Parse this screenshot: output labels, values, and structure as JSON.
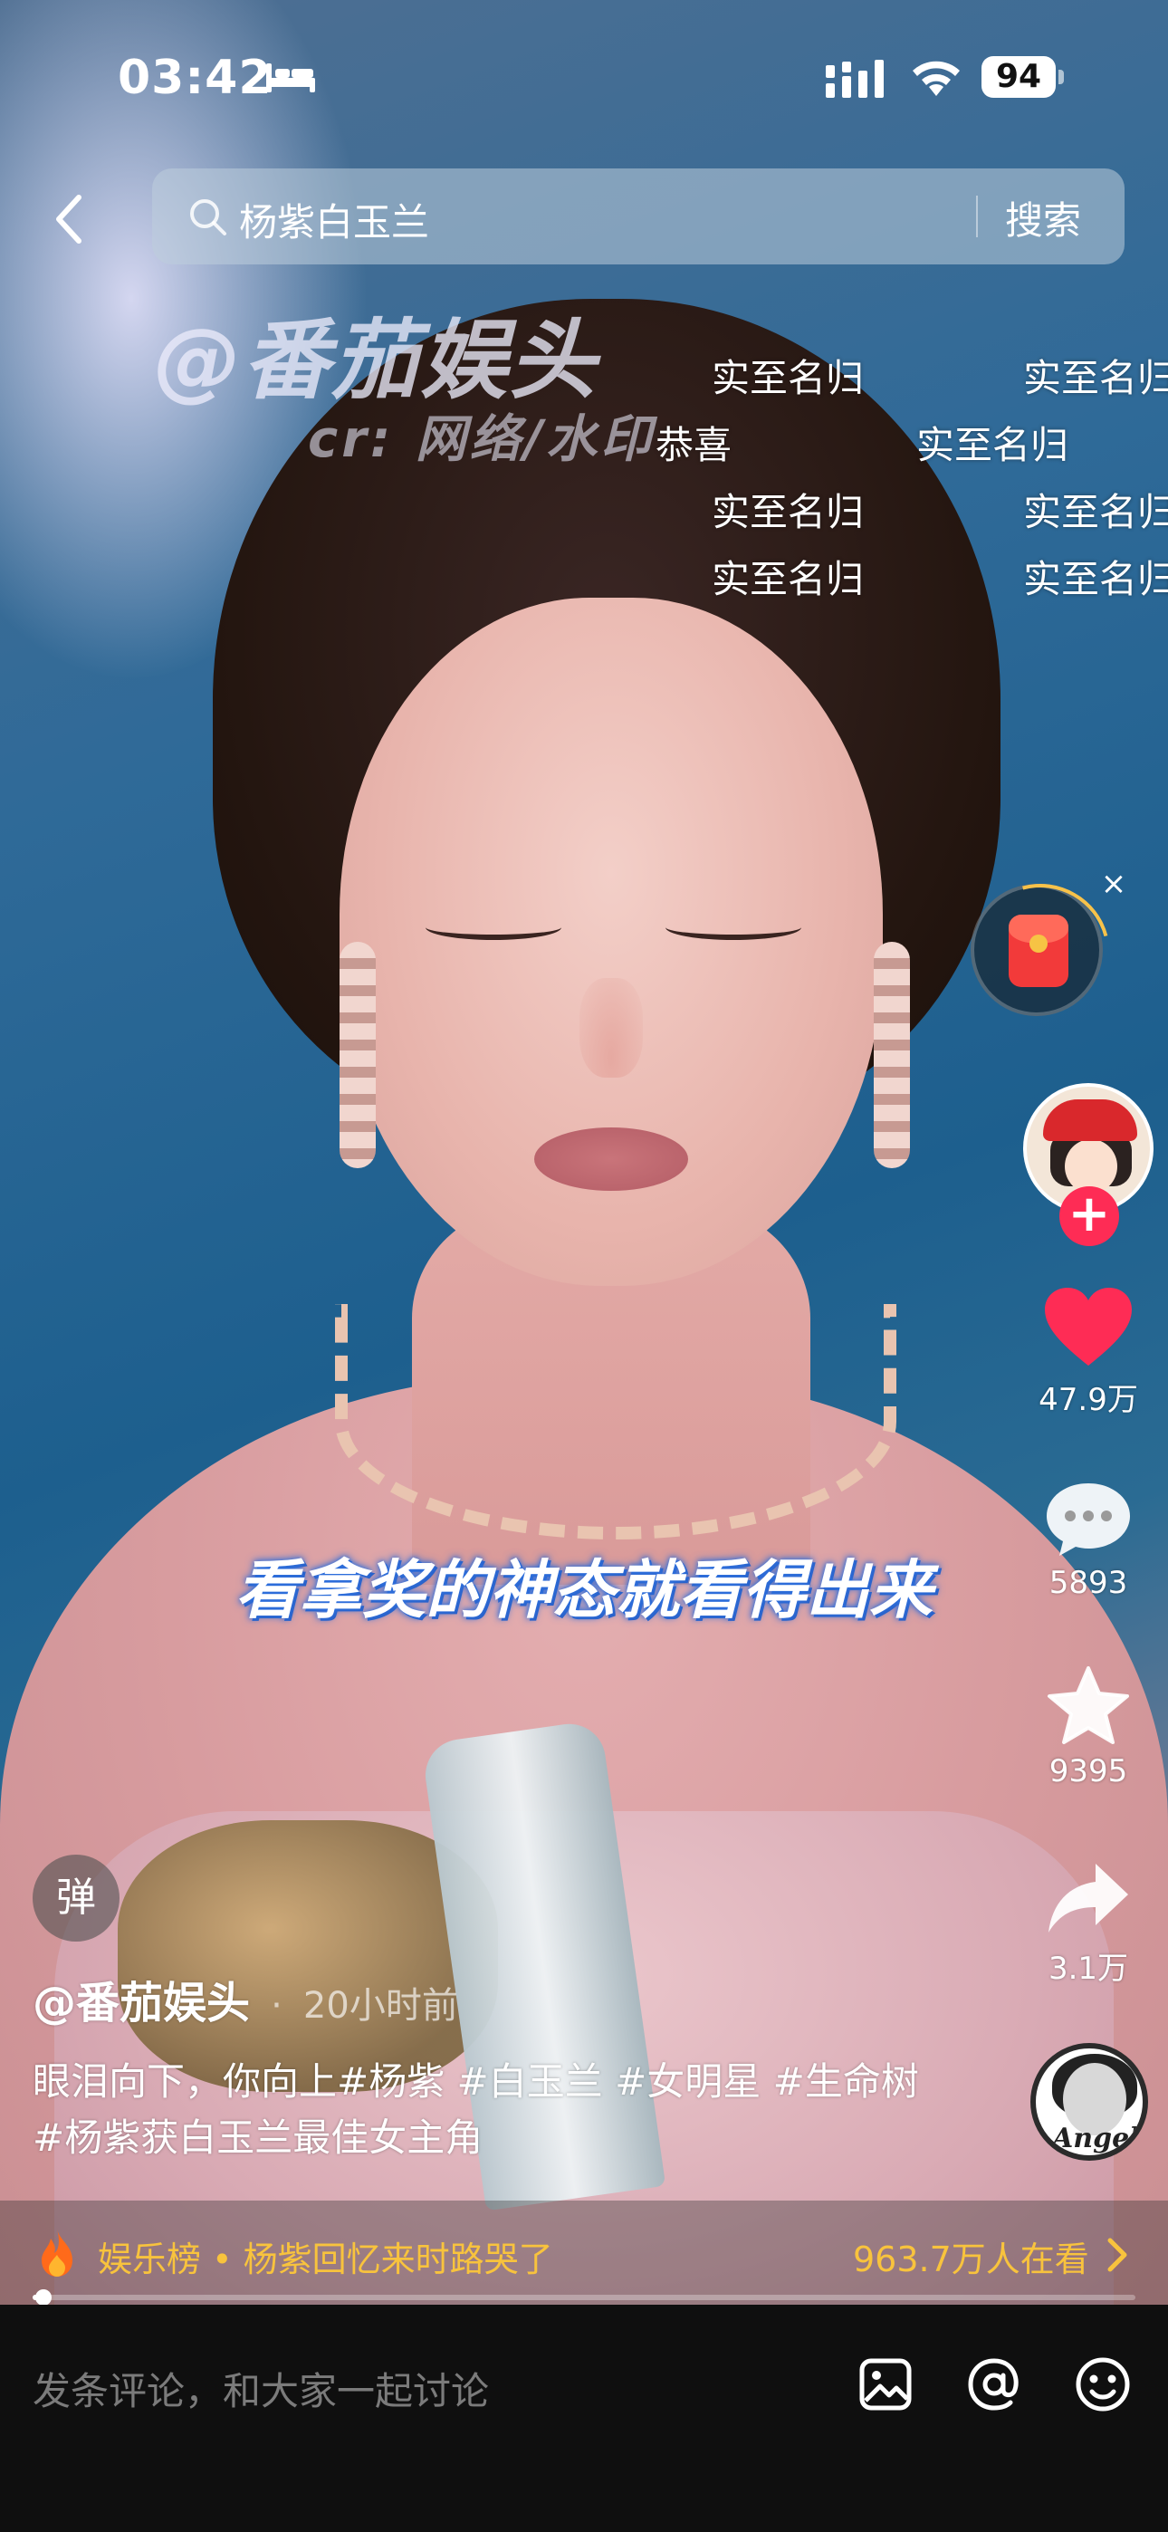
{
  "status_bar": {
    "time": "03:42",
    "battery": "94",
    "icons": [
      "bed-icon",
      "signal-icon",
      "wifi-icon",
      "battery-icon"
    ]
  },
  "search": {
    "query": "杨紫白玉兰",
    "button_label": "搜索"
  },
  "video": {
    "watermark": "@番茄娱头",
    "watermark_sub": "cr: 网络/水印",
    "subtitle": "看拿奖的神态就看得出来",
    "danmu": [
      "实至名归",
      "实至名归",
      "恭喜",
      "实至名归",
      "实至名归",
      "实至名归",
      "实至名归",
      "实至名归"
    ]
  },
  "side_actions": {
    "likes": "47.9万",
    "comments": "5893",
    "favorites": "9395",
    "shares": "3.1万",
    "follow_label": "+",
    "close_label": "×",
    "disc_label": "Angel"
  },
  "post": {
    "danmu_toggle": "弹",
    "author": "@番茄娱头",
    "separator": "·",
    "time": "20小时前",
    "caption": "眼泪向下，你向上#杨紫 #白玉兰 #女明星 #生命树 #杨紫获白玉兰最佳女主角"
  },
  "hot_list": {
    "title": "娱乐榜 • 杨紫回忆来时路哭了",
    "viewers": "963.7万人在看"
  },
  "progress": {
    "fraction": 0.01
  },
  "comment_bar": {
    "placeholder": "发条评论，和大家一起讨论"
  },
  "colors": {
    "accent_red": "#fe2c55",
    "like_red": "#fe2c55",
    "hot_yellow": "#f8c33d"
  }
}
